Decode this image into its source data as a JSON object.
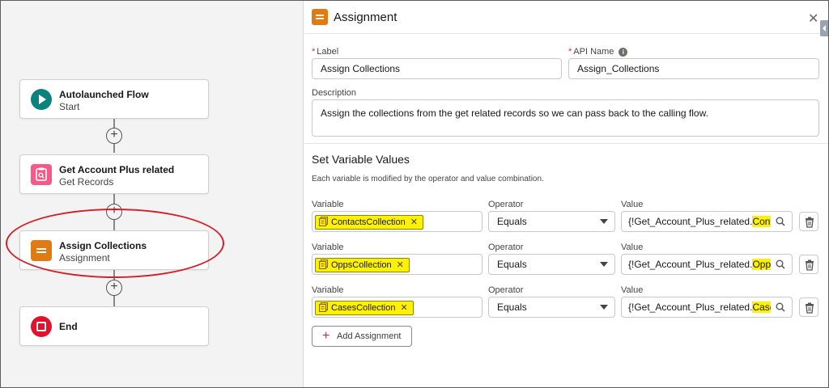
{
  "canvas": {
    "nodes": [
      {
        "title": "Autolaunched Flow",
        "subtitle": "Start",
        "icon": "play-icon",
        "color": "#0b827c"
      },
      {
        "title": "Get Account Plus related",
        "subtitle": "Get Records",
        "icon": "get-records-icon",
        "color": "#f25a8a"
      },
      {
        "title": "Assign Collections",
        "subtitle": "Assignment",
        "icon": "assignment-icon",
        "color": "#e07b14"
      },
      {
        "title": "End",
        "subtitle": "",
        "icon": "stop-icon",
        "color": "#e4112d"
      }
    ],
    "highlight_color": "#d0202a"
  },
  "panel": {
    "title": "Assignment",
    "label_label": "Label",
    "label_value": "Assign Collections",
    "api_name_label": "API Name",
    "api_name_value": "Assign_Collections",
    "description_label": "Description",
    "description_value": "Assign the collections from the get related records so we can pass back to the calling flow.",
    "section_title": "Set Variable Values",
    "section_desc": "Each variable is modified by the operator and value combination.",
    "col_variable": "Variable",
    "col_operator": "Operator",
    "col_value": "Value",
    "rows": [
      {
        "variable": "ContactsCollection",
        "operator": "Equals",
        "value_prefix": "{!Get_Account_Plus_related.",
        "value_suffix": "Contacts}"
      },
      {
        "variable": "OppsCollection",
        "operator": "Equals",
        "value_prefix": "{!Get_Account_Plus_related.",
        "value_suffix": "Opportun"
      },
      {
        "variable": "CasesCollection",
        "operator": "Equals",
        "value_prefix": "{!Get_Account_Plus_related.",
        "value_suffix": "Cases}"
      }
    ],
    "add_assignment_label": "Add Assignment",
    "accent_color": "#e07b14",
    "highlight_color": "#fff200"
  }
}
